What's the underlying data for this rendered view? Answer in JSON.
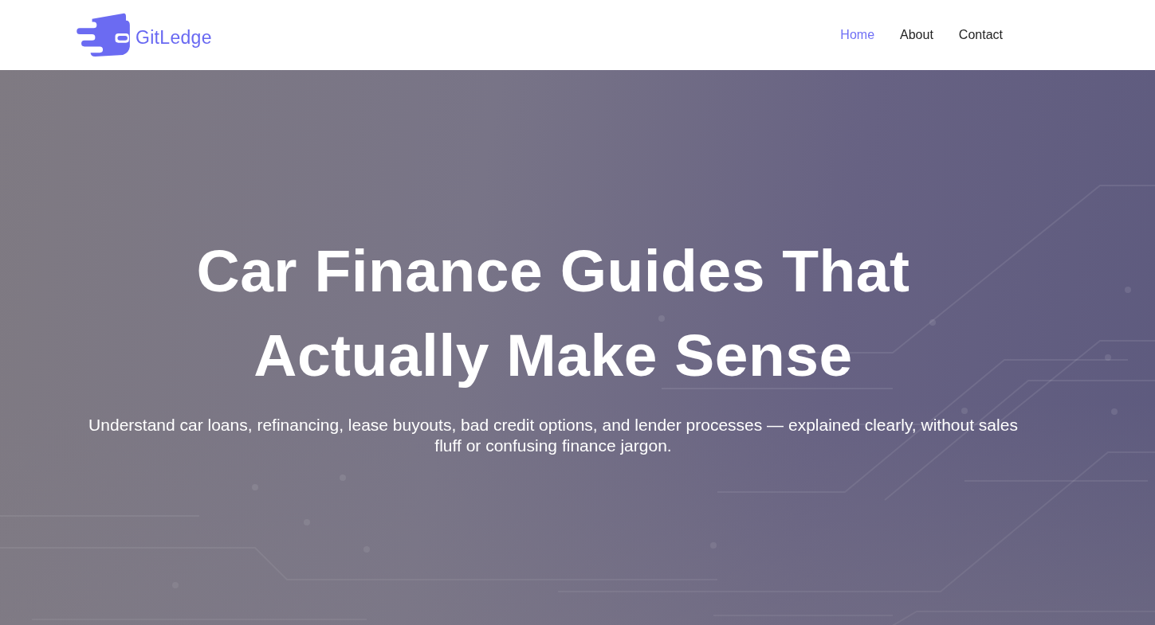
{
  "header": {
    "logo": {
      "text": "GitLedge"
    },
    "nav": [
      {
        "label": "Home",
        "selected": true
      },
      {
        "label": "About",
        "selected": false
      },
      {
        "label": "Contact",
        "selected": false
      }
    ]
  },
  "hero": {
    "title": "Car Finance Guides That Actually Make Sense",
    "subtitle": "Understand car loans, refinancing, lease buyouts, bad credit options, and lender processes — explained clearly, without sales fluff or confusing finance jargon."
  }
}
